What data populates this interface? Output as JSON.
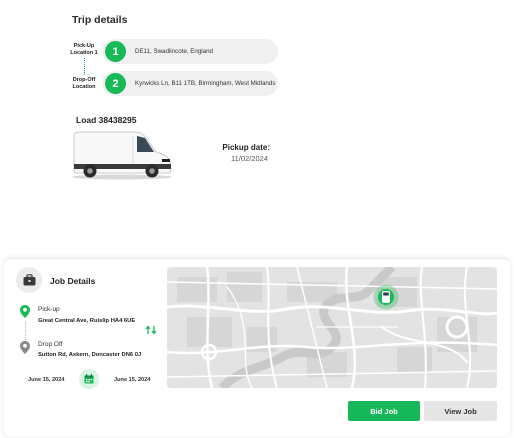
{
  "trip": {
    "title": "Trip details",
    "locations": [
      {
        "number": "1",
        "label": "Pick-Up Location 1",
        "address": "DE11, Swadlincote, England"
      },
      {
        "number": "2",
        "label": "Drop-Off Location",
        "address": "Kyrwicks Ln, B11 1TB, Birmingham, West Midlands"
      }
    ],
    "load_label": "Load 38438295",
    "pickup_label": "Pickup date:",
    "pickup_date": "11/02/2024"
  },
  "job": {
    "title": "Job Details",
    "pickup_label": "Pick-up",
    "pickup_address": "Great Central Ave, Ruislip HA4 6UE",
    "dropoff_label": "Drop Off",
    "dropoff_address": "Sutton Rd, Askern, Doncaster DN6 0J",
    "date_start": "June 15, 2024",
    "date_end": "June 15, 2024",
    "bid_label": "Bid Job",
    "view_label": "View Job"
  },
  "colors": {
    "accent": "#18b957",
    "pill_bg": "#f0f0f0",
    "map_bg": "#e4e4e4"
  },
  "icons": {
    "job": "briefcase-icon",
    "pickup": "map-pin-icon",
    "dropoff": "map-pin-icon",
    "swap": "swap-arrows-icon",
    "calendar": "calendar-icon",
    "map_marker": "van-marker-icon"
  }
}
